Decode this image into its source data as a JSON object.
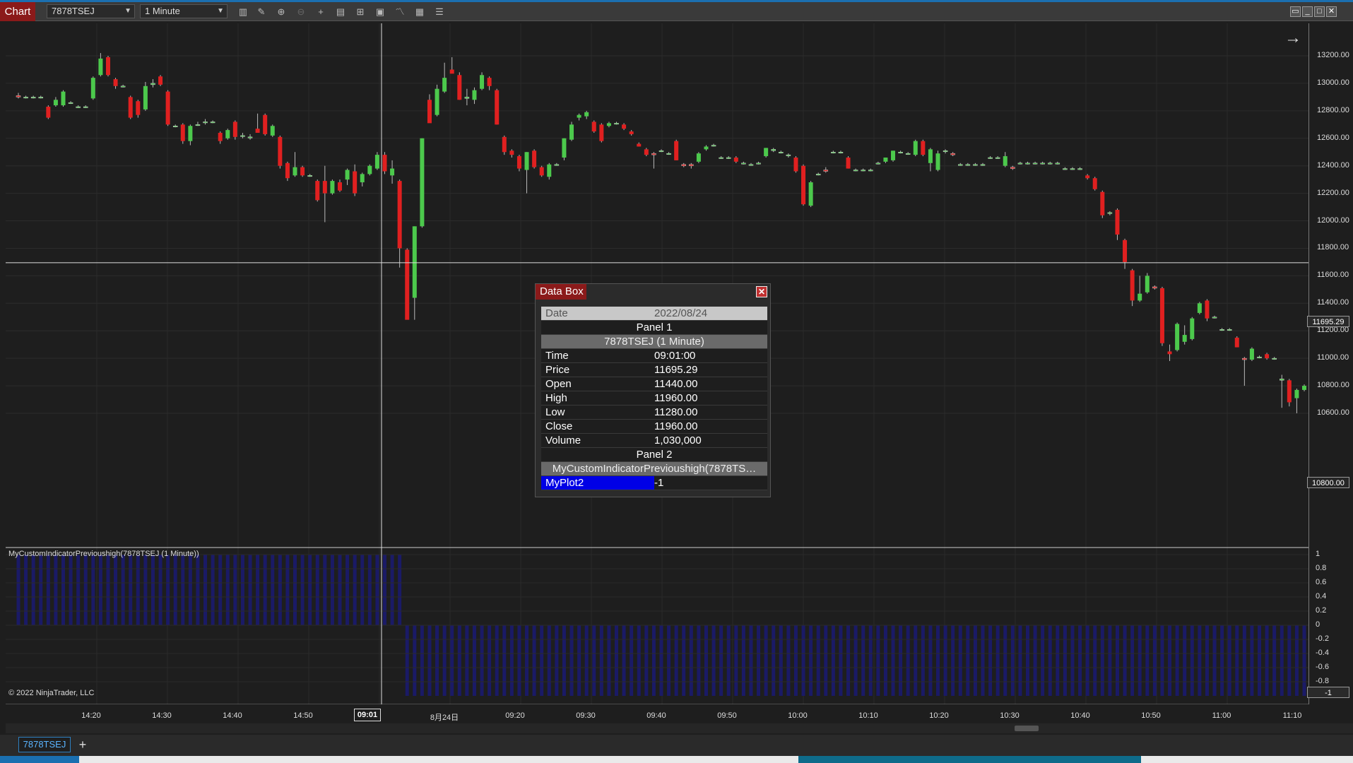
{
  "toolbar": {
    "chart_label": "Chart",
    "instrument": "7878TSEJ",
    "interval": "1 Minute"
  },
  "price_axis": {
    "ticks": [
      "13200.00",
      "13000.00",
      "12800.00",
      "12600.00",
      "12400.00",
      "12200.00",
      "12000.00",
      "11800.00",
      "11600.00",
      "11400.00",
      "11200.00",
      "11000.00",
      "10800.00",
      "10600.00"
    ],
    "crosshair_price": "11695.29",
    "last_price": "10800.00"
  },
  "indicator_axis": {
    "ticks": [
      "1",
      "0.8",
      "0.6",
      "0.4",
      "0.2",
      "0",
      "-0.2",
      "-0.4",
      "-0.6",
      "-0.8"
    ],
    "last_value": "-1"
  },
  "time_axis": {
    "labels": [
      "14:20",
      "14:30",
      "14:40",
      "14:50",
      "8月24日",
      "09:20",
      "09:30",
      "09:40",
      "09:50",
      "10:00",
      "10:10",
      "10:20",
      "10:30",
      "10:40",
      "10:50",
      "11:00",
      "11:10"
    ],
    "crosshair_time": "09:01"
  },
  "indicator_panel": {
    "label": "MyCustomIndicatorPrevioushigh(7878TSEJ (1 Minute))"
  },
  "copyright": "© 2022 NinjaTrader, LLC",
  "bottom": {
    "instrument_tab": "7878TSEJ",
    "add_tab": "+"
  },
  "databox": {
    "title": "Data Box",
    "date_label": "Date",
    "date_value": "2022/08/24",
    "panel1": "Panel 1",
    "series1": "7878TSEJ (1 Minute)",
    "rows": [
      {
        "k": "Time",
        "v": "09:01:00"
      },
      {
        "k": "Price",
        "v": "11695.29"
      },
      {
        "k": "Open",
        "v": "11440.00"
      },
      {
        "k": "High",
        "v": "11960.00"
      },
      {
        "k": "Low",
        "v": "11280.00"
      },
      {
        "k": "Close",
        "v": "11960.00"
      },
      {
        "k": "Volume",
        "v": "1,030,000"
      }
    ],
    "panel2": "Panel 2",
    "series2": "MyCustomIndicatorPrevioushigh(7878TS…",
    "plot_label": "MyPlot2",
    "plot_value": "-1"
  },
  "colors": {
    "up_candle": "#4cc94c",
    "down_candle": "#e02020",
    "indicator": "#1a1a6e",
    "background": "#1e1e1e"
  },
  "chart_data": {
    "type": "candlestick",
    "candles": [
      {
        "o": 12910,
        "h": 12930,
        "l": 12890,
        "c": 12900
      },
      {
        "o": 12900,
        "h": 12910,
        "l": 12890,
        "c": 12900
      },
      {
        "o": 12900,
        "h": 12910,
        "l": 12890,
        "c": 12900
      },
      {
        "o": 12900,
        "h": 12910,
        "l": 12890,
        "c": 12900
      },
      {
        "o": 12830,
        "h": 12840,
        "l": 12740,
        "c": 12750
      },
      {
        "o": 12840,
        "h": 12900,
        "l": 12830,
        "c": 12880
      },
      {
        "o": 12840,
        "h": 12950,
        "l": 12830,
        "c": 12940
      },
      {
        "o": 12860,
        "h": 12870,
        "l": 12850,
        "c": 12860
      },
      {
        "o": 12830,
        "h": 12840,
        "l": 12820,
        "c": 12830
      },
      {
        "o": 12830,
        "h": 12840,
        "l": 12820,
        "c": 12830
      },
      {
        "o": 12890,
        "h": 13050,
        "l": 12880,
        "c": 13040
      },
      {
        "o": 13060,
        "h": 13220,
        "l": 13050,
        "c": 13180
      },
      {
        "o": 13190,
        "h": 13200,
        "l": 13050,
        "c": 13060
      },
      {
        "o": 13030,
        "h": 13040,
        "l": 12960,
        "c": 12980
      },
      {
        "o": 12980,
        "h": 12990,
        "l": 12970,
        "c": 12980
      },
      {
        "o": 12900,
        "h": 12910,
        "l": 12740,
        "c": 12750
      },
      {
        "o": 12870,
        "h": 12880,
        "l": 12750,
        "c": 12770
      },
      {
        "o": 12810,
        "h": 13010,
        "l": 12800,
        "c": 12980
      },
      {
        "o": 12990,
        "h": 13030,
        "l": 12970,
        "c": 13000
      },
      {
        "o": 13050,
        "h": 13060,
        "l": 12980,
        "c": 12990
      },
      {
        "o": 12940,
        "h": 12950,
        "l": 12690,
        "c": 12700
      },
      {
        "o": 12690,
        "h": 12700,
        "l": 12680,
        "c": 12690
      },
      {
        "o": 12700,
        "h": 12710,
        "l": 12560,
        "c": 12580
      },
      {
        "o": 12580,
        "h": 12700,
        "l": 12550,
        "c": 12690
      },
      {
        "o": 12700,
        "h": 12720,
        "l": 12690,
        "c": 12700
      },
      {
        "o": 12720,
        "h": 12740,
        "l": 12700,
        "c": 12720
      },
      {
        "o": 12720,
        "h": 12730,
        "l": 12710,
        "c": 12720
      },
      {
        "o": 12640,
        "h": 12650,
        "l": 12560,
        "c": 12580
      },
      {
        "o": 12600,
        "h": 12670,
        "l": 12590,
        "c": 12660
      },
      {
        "o": 12720,
        "h": 12730,
        "l": 12590,
        "c": 12610
      },
      {
        "o": 12620,
        "h": 12640,
        "l": 12600,
        "c": 12620
      },
      {
        "o": 12610,
        "h": 12630,
        "l": 12590,
        "c": 12610
      },
      {
        "o": 12670,
        "h": 12780,
        "l": 12660,
        "c": 12640
      },
      {
        "o": 12770,
        "h": 12780,
        "l": 12620,
        "c": 12630
      },
      {
        "o": 12620,
        "h": 12700,
        "l": 12610,
        "c": 12690
      },
      {
        "o": 12610,
        "h": 12620,
        "l": 12380,
        "c": 12400
      },
      {
        "o": 12420,
        "h": 12430,
        "l": 12290,
        "c": 12310
      },
      {
        "o": 12330,
        "h": 12500,
        "l": 12320,
        "c": 12390
      },
      {
        "o": 12390,
        "h": 12400,
        "l": 12320,
        "c": 12330
      },
      {
        "o": 12330,
        "h": 12340,
        "l": 12320,
        "c": 12330
      },
      {
        "o": 12290,
        "h": 12300,
        "l": 12140,
        "c": 12150
      },
      {
        "o": 12290,
        "h": 12400,
        "l": 11990,
        "c": 12200
      },
      {
        "o": 12200,
        "h": 12300,
        "l": 12190,
        "c": 12290
      },
      {
        "o": 12280,
        "h": 12300,
        "l": 12210,
        "c": 12220
      },
      {
        "o": 12300,
        "h": 12380,
        "l": 12260,
        "c": 12370
      },
      {
        "o": 12360,
        "h": 12410,
        "l": 12180,
        "c": 12200
      },
      {
        "o": 12280,
        "h": 12350,
        "l": 12250,
        "c": 12340
      },
      {
        "o": 12340,
        "h": 12410,
        "l": 12330,
        "c": 12400
      },
      {
        "o": 12380,
        "h": 12500,
        "l": 12370,
        "c": 12480
      },
      {
        "o": 12480,
        "h": 12500,
        "l": 12340,
        "c": 12360
      },
      {
        "o": 12330,
        "h": 12440,
        "l": 12270,
        "c": 12380
      },
      {
        "o": 12290,
        "h": 12300,
        "l": 11660,
        "c": 11800
      },
      {
        "o": 11790,
        "h": 11800,
        "l": 11300,
        "c": 11280
      },
      {
        "o": 11440,
        "h": 11960,
        "l": 11280,
        "c": 11960
      },
      {
        "o": 11960,
        "h": 12600,
        "l": 11950,
        "c": 12600
      },
      {
        "o": 12880,
        "h": 12920,
        "l": 12720,
        "c": 12710
      },
      {
        "o": 12770,
        "h": 12990,
        "l": 12760,
        "c": 12960
      },
      {
        "o": 12940,
        "h": 13150,
        "l": 12930,
        "c": 13040
      },
      {
        "o": 13100,
        "h": 13190,
        "l": 13080,
        "c": 13070
      },
      {
        "o": 13060,
        "h": 13080,
        "l": 12880,
        "c": 12880
      },
      {
        "o": 12890,
        "h": 12960,
        "l": 12840,
        "c": 12900
      },
      {
        "o": 12880,
        "h": 12970,
        "l": 12850,
        "c": 12950
      },
      {
        "o": 12960,
        "h": 13080,
        "l": 12950,
        "c": 13060
      },
      {
        "o": 13040,
        "h": 13050,
        "l": 12950,
        "c": 12980
      },
      {
        "o": 12950,
        "h": 12960,
        "l": 12700,
        "c": 12700
      },
      {
        "o": 12610,
        "h": 12620,
        "l": 12480,
        "c": 12500
      },
      {
        "o": 12510,
        "h": 12520,
        "l": 12460,
        "c": 12480
      },
      {
        "o": 12470,
        "h": 12480,
        "l": 12360,
        "c": 12380
      },
      {
        "o": 12370,
        "h": 12500,
        "l": 12200,
        "c": 12500
      },
      {
        "o": 12510,
        "h": 12520,
        "l": 12380,
        "c": 12390
      },
      {
        "o": 12390,
        "h": 12400,
        "l": 12320,
        "c": 12330
      },
      {
        "o": 12320,
        "h": 12420,
        "l": 12300,
        "c": 12410
      },
      {
        "o": 12410,
        "h": 12420,
        "l": 12400,
        "c": 12410
      },
      {
        "o": 12460,
        "h": 12600,
        "l": 12440,
        "c": 12600
      },
      {
        "o": 12590,
        "h": 12720,
        "l": 12580,
        "c": 12700
      },
      {
        "o": 12750,
        "h": 12780,
        "l": 12730,
        "c": 12770
      },
      {
        "o": 12760,
        "h": 12800,
        "l": 12740,
        "c": 12790
      },
      {
        "o": 12720,
        "h": 12730,
        "l": 12640,
        "c": 12650
      },
      {
        "o": 12700,
        "h": 12710,
        "l": 12570,
        "c": 12580
      },
      {
        "o": 12690,
        "h": 12720,
        "l": 12680,
        "c": 12710
      },
      {
        "o": 12710,
        "h": 12720,
        "l": 12700,
        "c": 12710
      },
      {
        "o": 12700,
        "h": 12710,
        "l": 12660,
        "c": 12670
      },
      {
        "o": 12650,
        "h": 12660,
        "l": 12620,
        "c": 12630
      },
      {
        "o": 12560,
        "h": 12570,
        "l": 12540,
        "c": 12540
      },
      {
        "o": 12520,
        "h": 12530,
        "l": 12470,
        "c": 12480
      },
      {
        "o": 12490,
        "h": 12500,
        "l": 12380,
        "c": 12480
      },
      {
        "o": 12510,
        "h": 12520,
        "l": 12500,
        "c": 12510
      },
      {
        "o": 12490,
        "h": 12500,
        "l": 12480,
        "c": 12490
      },
      {
        "o": 12580,
        "h": 12590,
        "l": 12440,
        "c": 12440
      },
      {
        "o": 12410,
        "h": 12420,
        "l": 12390,
        "c": 12400
      },
      {
        "o": 12410,
        "h": 12420,
        "l": 12380,
        "c": 12400
      },
      {
        "o": 12430,
        "h": 12500,
        "l": 12420,
        "c": 12490
      },
      {
        "o": 12520,
        "h": 12550,
        "l": 12510,
        "c": 12540
      },
      {
        "o": 12550,
        "h": 12560,
        "l": 12540,
        "c": 12550
      },
      {
        "o": 12460,
        "h": 12470,
        "l": 12450,
        "c": 12460
      },
      {
        "o": 12460,
        "h": 12470,
        "l": 12450,
        "c": 12460
      },
      {
        "o": 12460,
        "h": 12470,
        "l": 12420,
        "c": 12430
      },
      {
        "o": 12420,
        "h": 12430,
        "l": 12410,
        "c": 12420
      },
      {
        "o": 12410,
        "h": 12420,
        "l": 12400,
        "c": 12410
      },
      {
        "o": 12420,
        "h": 12430,
        "l": 12410,
        "c": 12420
      },
      {
        "o": 12470,
        "h": 12530,
        "l": 12460,
        "c": 12530
      },
      {
        "o": 12510,
        "h": 12530,
        "l": 12500,
        "c": 12520
      },
      {
        "o": 12500,
        "h": 12510,
        "l": 12490,
        "c": 12500
      },
      {
        "o": 12480,
        "h": 12490,
        "l": 12460,
        "c": 12480
      },
      {
        "o": 12460,
        "h": 12470,
        "l": 12350,
        "c": 12360
      },
      {
        "o": 12400,
        "h": 12410,
        "l": 12110,
        "c": 12120
      },
      {
        "o": 12110,
        "h": 12290,
        "l": 12100,
        "c": 12280
      },
      {
        "o": 12340,
        "h": 12350,
        "l": 12330,
        "c": 12340
      },
      {
        "o": 12370,
        "h": 12390,
        "l": 12350,
        "c": 12360
      },
      {
        "o": 12500,
        "h": 12510,
        "l": 12490,
        "c": 12500
      },
      {
        "o": 12500,
        "h": 12510,
        "l": 12490,
        "c": 12500
      },
      {
        "o": 12460,
        "h": 12470,
        "l": 12380,
        "c": 12380
      },
      {
        "o": 12370,
        "h": 12380,
        "l": 12360,
        "c": 12370
      },
      {
        "o": 12370,
        "h": 12380,
        "l": 12360,
        "c": 12370
      },
      {
        "o": 12370,
        "h": 12380,
        "l": 12360,
        "c": 12370
      },
      {
        "o": 12420,
        "h": 12430,
        "l": 12410,
        "c": 12420
      },
      {
        "o": 12430,
        "h": 12460,
        "l": 12420,
        "c": 12460
      },
      {
        "o": 12440,
        "h": 12510,
        "l": 12430,
        "c": 12510
      },
      {
        "o": 12500,
        "h": 12510,
        "l": 12490,
        "c": 12500
      },
      {
        "o": 12490,
        "h": 12500,
        "l": 12480,
        "c": 12490
      },
      {
        "o": 12480,
        "h": 12590,
        "l": 12470,
        "c": 12580
      },
      {
        "o": 12580,
        "h": 12590,
        "l": 12470,
        "c": 12480
      },
      {
        "o": 12420,
        "h": 12530,
        "l": 12360,
        "c": 12520
      },
      {
        "o": 12370,
        "h": 12510,
        "l": 12360,
        "c": 12490
      },
      {
        "o": 12510,
        "h": 12520,
        "l": 12490,
        "c": 12510
      },
      {
        "o": 12490,
        "h": 12500,
        "l": 12470,
        "c": 12480
      },
      {
        "o": 12410,
        "h": 12420,
        "l": 12400,
        "c": 12410
      },
      {
        "o": 12410,
        "h": 12420,
        "l": 12400,
        "c": 12410
      },
      {
        "o": 12410,
        "h": 12420,
        "l": 12400,
        "c": 12410
      },
      {
        "o": 12410,
        "h": 12420,
        "l": 12400,
        "c": 12410
      },
      {
        "o": 12460,
        "h": 12470,
        "l": 12450,
        "c": 12460
      },
      {
        "o": 12460,
        "h": 12470,
        "l": 12450,
        "c": 12460
      },
      {
        "o": 12400,
        "h": 12500,
        "l": 12390,
        "c": 12470
      },
      {
        "o": 12390,
        "h": 12400,
        "l": 12370,
        "c": 12380
      },
      {
        "o": 12420,
        "h": 12430,
        "l": 12410,
        "c": 12420
      },
      {
        "o": 12420,
        "h": 12430,
        "l": 12410,
        "c": 12420
      },
      {
        "o": 12420,
        "h": 12430,
        "l": 12410,
        "c": 12420
      },
      {
        "o": 12420,
        "h": 12430,
        "l": 12410,
        "c": 12420
      },
      {
        "o": 12420,
        "h": 12430,
        "l": 12410,
        "c": 12420
      },
      {
        "o": 12420,
        "h": 12430,
        "l": 12410,
        "c": 12420
      },
      {
        "o": 12380,
        "h": 12390,
        "l": 12370,
        "c": 12380
      },
      {
        "o": 12380,
        "h": 12390,
        "l": 12370,
        "c": 12380
      },
      {
        "o": 12380,
        "h": 12390,
        "l": 12370,
        "c": 12380
      },
      {
        "o": 12330,
        "h": 12340,
        "l": 12300,
        "c": 12310
      },
      {
        "o": 12310,
        "h": 12320,
        "l": 12220,
        "c": 12230
      },
      {
        "o": 12210,
        "h": 12220,
        "l": 12020,
        "c": 12040
      },
      {
        "o": 12060,
        "h": 12070,
        "l": 12040,
        "c": 12060
      },
      {
        "o": 12080,
        "h": 12090,
        "l": 11860,
        "c": 11900
      },
      {
        "o": 11860,
        "h": 11870,
        "l": 11650,
        "c": 11700
      },
      {
        "o": 11640,
        "h": 11650,
        "l": 11380,
        "c": 11420
      },
      {
        "o": 11420,
        "h": 11600,
        "l": 11410,
        "c": 11470
      },
      {
        "o": 11480,
        "h": 11620,
        "l": 11470,
        "c": 11600
      },
      {
        "o": 11520,
        "h": 11530,
        "l": 11500,
        "c": 11510
      },
      {
        "o": 11510,
        "h": 11520,
        "l": 11090,
        "c": 11110
      },
      {
        "o": 11050,
        "h": 11100,
        "l": 10980,
        "c": 11030
      },
      {
        "o": 11060,
        "h": 11260,
        "l": 11050,
        "c": 11250
      },
      {
        "o": 11120,
        "h": 11240,
        "l": 11100,
        "c": 11170
      },
      {
        "o": 11140,
        "h": 11300,
        "l": 11130,
        "c": 11290
      },
      {
        "o": 11330,
        "h": 11410,
        "l": 11320,
        "c": 11400
      },
      {
        "o": 11420,
        "h": 11430,
        "l": 11270,
        "c": 11290
      },
      {
        "o": 11300,
        "h": 11310,
        "l": 11290,
        "c": 11300
      },
      {
        "o": 11210,
        "h": 11220,
        "l": 11200,
        "c": 11210
      },
      {
        "o": 11210,
        "h": 11220,
        "l": 11200,
        "c": 11210
      },
      {
        "o": 11150,
        "h": 11160,
        "l": 11080,
        "c": 11080
      },
      {
        "o": 11000,
        "h": 11010,
        "l": 10800,
        "c": 10990
      },
      {
        "o": 10990,
        "h": 11080,
        "l": 10980,
        "c": 11070
      },
      {
        "o": 11010,
        "h": 11020,
        "l": 11000,
        "c": 11010
      },
      {
        "o": 11030,
        "h": 11040,
        "l": 10990,
        "c": 11000
      },
      {
        "o": 11000,
        "h": 11010,
        "l": 10990,
        "c": 11000
      },
      {
        "o": 10840,
        "h": 10880,
        "l": 10640,
        "c": 10850
      },
      {
        "o": 10840,
        "h": 10850,
        "l": 10650,
        "c": 10680
      },
      {
        "o": 10710,
        "h": 10780,
        "l": 10600,
        "c": 10770
      },
      {
        "o": 10770,
        "h": 10810,
        "l": 10760,
        "c": 10800
      }
    ],
    "price_range": [
      10500,
      13300
    ],
    "indicator": {
      "name": "MyPlot2",
      "range": [
        -1,
        1
      ],
      "values_before_crosshair": 1,
      "values_after_crosshair": -1
    }
  }
}
